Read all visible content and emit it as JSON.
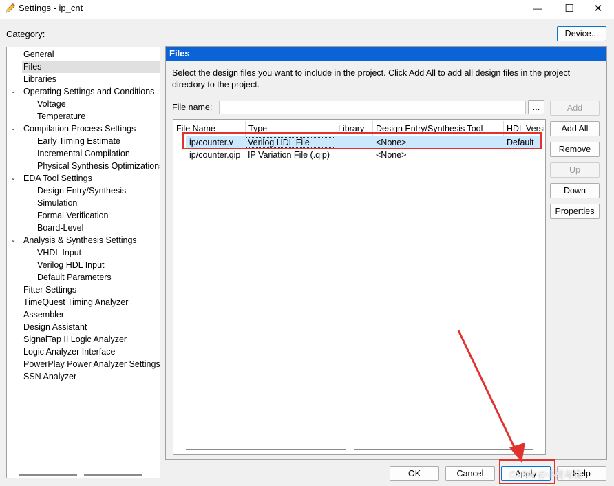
{
  "window": {
    "title": "Settings - ip_cnt",
    "minimize_glyph": "—",
    "maximize_glyph": "☐",
    "close_glyph": "✕"
  },
  "category_label": "Category:",
  "device_button": "Device...",
  "tree": {
    "items": [
      {
        "label": "General",
        "level": 0,
        "expander": ""
      },
      {
        "label": "Files",
        "level": 0,
        "expander": "",
        "selected": true
      },
      {
        "label": "Libraries",
        "level": 0,
        "expander": ""
      },
      {
        "label": "Operating Settings and Conditions",
        "level": 0,
        "expander": "⌄"
      },
      {
        "label": "Voltage",
        "level": 1,
        "expander": ""
      },
      {
        "label": "Temperature",
        "level": 1,
        "expander": ""
      },
      {
        "label": "Compilation Process Settings",
        "level": 0,
        "expander": "⌄"
      },
      {
        "label": "Early Timing Estimate",
        "level": 1,
        "expander": ""
      },
      {
        "label": "Incremental Compilation",
        "level": 1,
        "expander": ""
      },
      {
        "label": "Physical Synthesis Optimizations",
        "level": 1,
        "expander": ""
      },
      {
        "label": "EDA Tool Settings",
        "level": 0,
        "expander": "⌄"
      },
      {
        "label": "Design Entry/Synthesis",
        "level": 1,
        "expander": ""
      },
      {
        "label": "Simulation",
        "level": 1,
        "expander": ""
      },
      {
        "label": "Formal Verification",
        "level": 1,
        "expander": ""
      },
      {
        "label": "Board-Level",
        "level": 1,
        "expander": ""
      },
      {
        "label": "Analysis & Synthesis Settings",
        "level": 0,
        "expander": "⌄"
      },
      {
        "label": "VHDL Input",
        "level": 1,
        "expander": ""
      },
      {
        "label": "Verilog HDL Input",
        "level": 1,
        "expander": ""
      },
      {
        "label": "Default Parameters",
        "level": 1,
        "expander": ""
      },
      {
        "label": "Fitter Settings",
        "level": 0,
        "expander": ""
      },
      {
        "label": "TimeQuest Timing Analyzer",
        "level": 0,
        "expander": ""
      },
      {
        "label": "Assembler",
        "level": 0,
        "expander": ""
      },
      {
        "label": "Design Assistant",
        "level": 0,
        "expander": ""
      },
      {
        "label": "SignalTap II Logic Analyzer",
        "level": 0,
        "expander": ""
      },
      {
        "label": "Logic Analyzer Interface",
        "level": 0,
        "expander": ""
      },
      {
        "label": "PowerPlay Power Analyzer Settings",
        "level": 0,
        "expander": ""
      },
      {
        "label": "SSN Analyzer",
        "level": 0,
        "expander": ""
      }
    ]
  },
  "panel": {
    "title": "Files",
    "description": "Select the design files you want to include in the project. Click Add All to add all design files in the project directory to the project.",
    "file_name_label": "File name:",
    "file_name_value": "",
    "browse_label": "...",
    "columns": [
      "File Name",
      "Type",
      "Library",
      "Design Entry/Synthesis Tool",
      "HDL Version"
    ],
    "rows": [
      {
        "file": "ip/counter.v",
        "type": "Verilog HDL File",
        "library": "",
        "tool": "<None>",
        "hdl": "Default",
        "selected": true
      },
      {
        "file": "ip/counter.qip",
        "type": "IP Variation File (.qip)",
        "library": "",
        "tool": "<None>",
        "hdl": "",
        "selected": false
      }
    ],
    "side_buttons": [
      {
        "label": "Add",
        "enabled": false
      },
      {
        "label": "Add All",
        "enabled": true
      },
      {
        "label": "Remove",
        "enabled": true
      },
      {
        "label": "Up",
        "enabled": false
      },
      {
        "label": "Down",
        "enabled": true
      },
      {
        "label": "Properties",
        "enabled": true
      }
    ]
  },
  "footer": {
    "ok": "OK",
    "cancel": "Cancel",
    "apply": "Apply",
    "help": "Help"
  },
  "watermark": "CSDN @小夏与酒",
  "colors": {
    "header_blue": "#0a64d8",
    "selection": "#cce8ff",
    "annotation_red": "#e0332e"
  }
}
